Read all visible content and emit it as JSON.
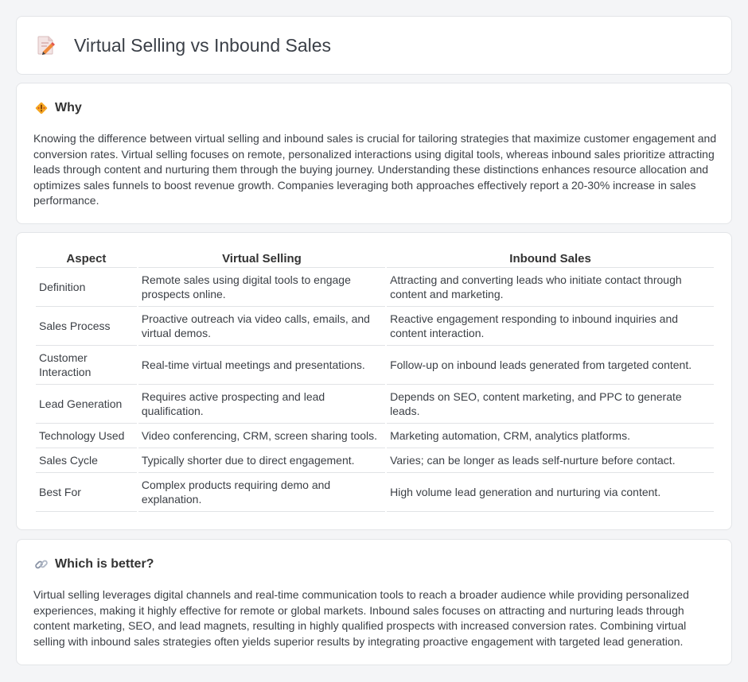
{
  "header": {
    "title": "Virtual Selling vs Inbound Sales",
    "icon": "document-pencil-icon"
  },
  "why": {
    "heading": "Why",
    "icon": "diamond-warning-icon",
    "text": "Knowing the difference between virtual selling and inbound sales is crucial for tailoring strategies that maximize customer engagement and conversion rates. Virtual selling focuses on remote, personalized interactions using digital tools, whereas inbound sales prioritize attracting leads through content and nurturing them through the buying journey. Understanding these distinctions enhances resource allocation and optimizes sales funnels to boost revenue growth. Companies leveraging both approaches effectively report a 20-30% increase in sales performance."
  },
  "comparison": {
    "headers": [
      "Aspect",
      "Virtual Selling",
      "Inbound Sales"
    ],
    "rows": [
      [
        "Definition",
        "Remote sales using digital tools to engage prospects online.",
        "Attracting and converting leads who initiate contact through content and marketing."
      ],
      [
        "Sales Process",
        "Proactive outreach via video calls, emails, and virtual demos.",
        "Reactive engagement responding to inbound inquiries and content interaction."
      ],
      [
        "Customer Interaction",
        "Real-time virtual meetings and presentations.",
        "Follow-up on inbound leads generated from targeted content."
      ],
      [
        "Lead Generation",
        "Requires active prospecting and lead qualification.",
        "Depends on SEO, content marketing, and PPC to generate leads."
      ],
      [
        "Technology Used",
        "Video conferencing, CRM, screen sharing tools.",
        "Marketing automation, CRM, analytics platforms."
      ],
      [
        "Sales Cycle",
        "Typically shorter due to direct engagement.",
        "Varies; can be longer as leads self-nurture before contact."
      ],
      [
        "Best For",
        "Complex products requiring demo and explanation.",
        "High volume lead generation and nurturing via content."
      ]
    ]
  },
  "better": {
    "heading": "Which is better?",
    "icon": "link-icon",
    "text": "Virtual selling leverages digital channels and real-time communication tools to reach a broader audience while providing personalized experiences, making it highly effective for remote or global markets. Inbound sales focuses on attracting and nurturing leads through content marketing, SEO, and lead magnets, resulting in highly qualified prospects with increased conversion rates. Combining virtual selling with inbound sales strategies often yields superior results by integrating proactive engagement with targeted lead generation."
  }
}
